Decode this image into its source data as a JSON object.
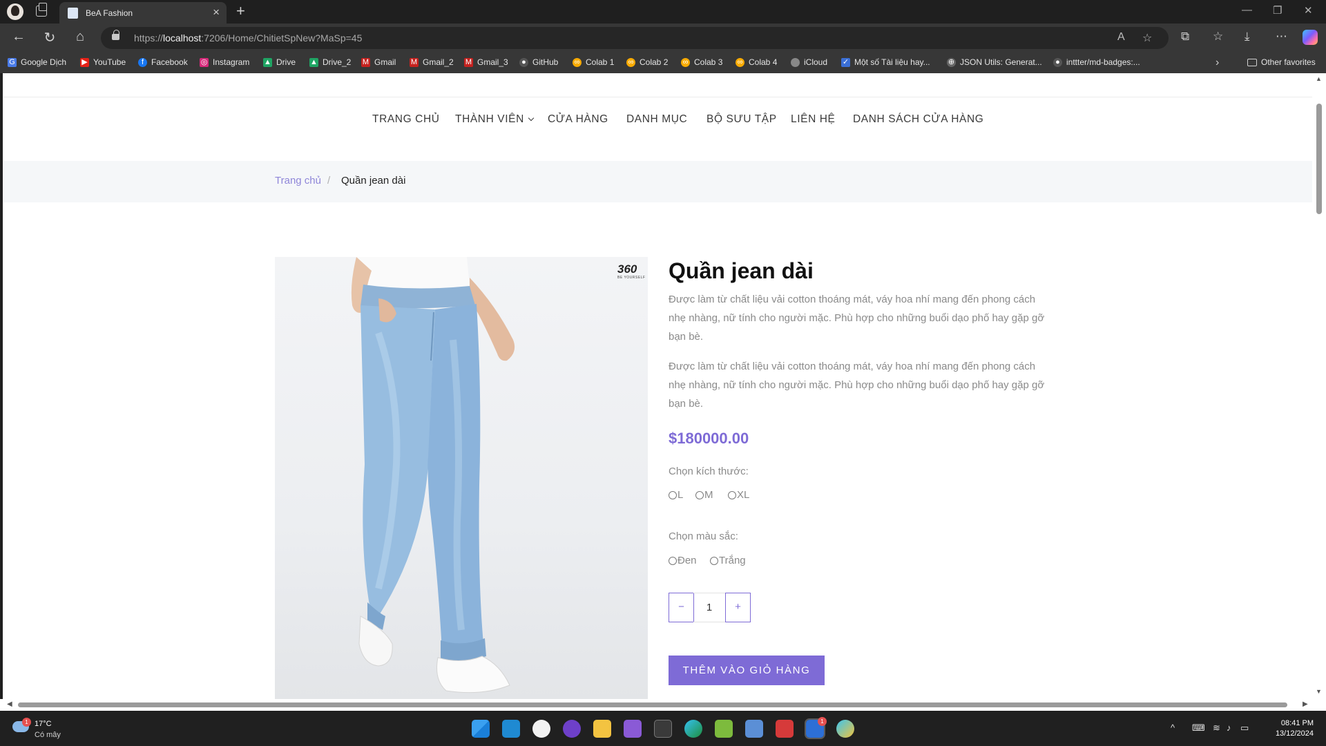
{
  "browser": {
    "tab_title": "BeA Fashion",
    "url_prefix": "https://",
    "url_host": "localhost",
    "url_rest": ":7206/Home/ChitietSpNew?MaSp=45",
    "bookmarks": [
      "Google Dịch",
      "YouTube",
      "Facebook",
      "Instagram",
      "Drive",
      "Drive_2",
      "Gmail",
      "Gmail_2",
      "Gmail_3",
      "GitHub",
      "Colab 1",
      "Colab 2",
      "Colab 3",
      "Colab 4",
      "iCloud",
      "Một số Tài liệu hay...",
      "JSON Utils: Generat...",
      "inttter/md-badges:..."
    ],
    "other_favorites": "Other favorites"
  },
  "menu": {
    "home": "TRANG CHỦ",
    "members": "THÀNH VIÊN",
    "shop": "CỬA HÀNG",
    "categories": "DANH MỤC",
    "collection": "BỘ SƯU TẬP",
    "contact": "LIÊN HỆ",
    "stores": "DANH SÁCH CỬA HÀNG"
  },
  "breadcrumb": {
    "home": "Trang chủ",
    "separator": "/",
    "current": "Quần jean dài"
  },
  "product": {
    "brand_logo": "360",
    "brand_sub": "BE YOURSELF",
    "title": "Quần jean dài",
    "description_1": "Được làm từ chất liệu vải cotton thoáng mát, váy hoa nhí mang đến phong cách nhẹ nhàng, nữ tính cho người mặc. Phù hợp cho những buổi dạo phố hay gặp gỡ bạn bè.",
    "description_2": "Được làm từ chất liệu vải cotton thoáng mát, váy hoa nhí mang đến phong cách nhẹ nhàng, nữ tính cho người mặc. Phù hợp cho những buổi dạo phố hay gặp gỡ bạn bè.",
    "price": "$180000.00",
    "size_label": "Chọn kích thước:",
    "sizes": [
      "L",
      "M",
      "XL"
    ],
    "color_label": "Chọn màu sắc:",
    "colors": [
      "Đen",
      "Trắng"
    ],
    "quantity": "1",
    "minus": "−",
    "plus": "+",
    "add_to_cart": "THÊM VÀO GIỎ HÀNG",
    "accent_color": "#7e6bd6"
  },
  "taskbar": {
    "temp": "17°C",
    "condition": "Có mây",
    "weather_badge": "1",
    "zalo_badge": "1",
    "time": "08:41 PM",
    "date": "13/12/2024"
  }
}
